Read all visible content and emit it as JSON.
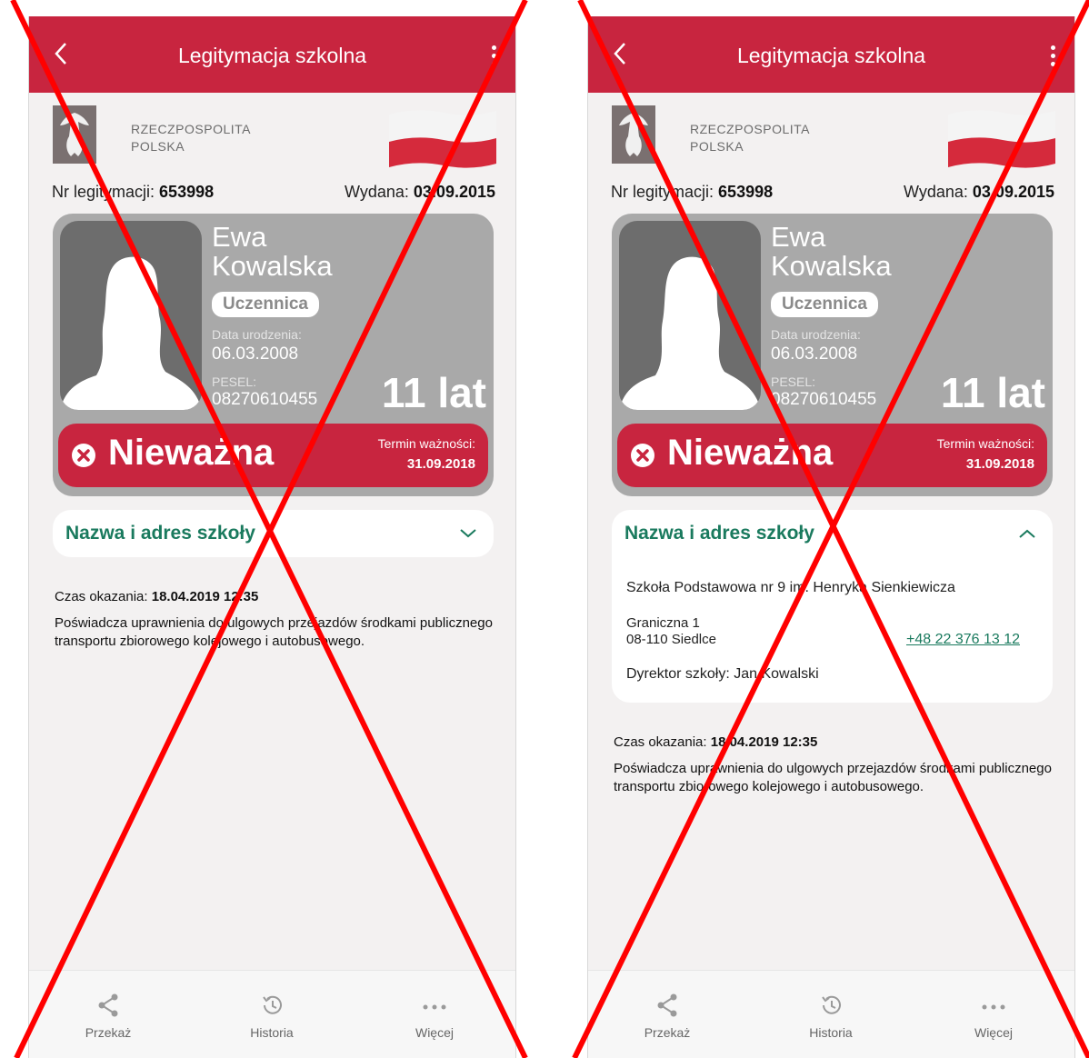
{
  "screens": [
    {
      "header": {
        "title": "Legitymacja szkolna"
      },
      "emblem": {
        "line1": "RZECZPOSPOLITA",
        "line2": "POLSKA"
      },
      "id_number": {
        "label": "Nr legitymacji:",
        "value": "653998"
      },
      "issued": {
        "label": "Wydana:",
        "value": "03.09.2015"
      },
      "card": {
        "first_name": "Ewa",
        "last_name": "Kowalska",
        "role": "Uczennica",
        "dob_label": "Data urodzenia:",
        "dob": "06.03.2008",
        "pesel_label": "PESEL:",
        "pesel": "08270610455",
        "age": "11 lat",
        "status": "Nieważna",
        "valid_label": "Termin ważności:",
        "valid_until": "31.09.2018"
      },
      "school": {
        "title": "Nazwa i adres szkoły",
        "expanded": false
      },
      "shown_time": {
        "label": "Czas okazania:",
        "value": "18.04.2019 12:35"
      },
      "entitlement": "Poświadcza uprawnienia do ulgowych przejazdów środkami publicznego transportu zbiorowego kolejowego i autobusowego.",
      "nav": {
        "share": "Przekaż",
        "history": "Historia",
        "more": "Więcej"
      }
    },
    {
      "header": {
        "title": "Legitymacja szkolna"
      },
      "emblem": {
        "line1": "RZECZPOSPOLITA",
        "line2": "POLSKA"
      },
      "id_number": {
        "label": "Nr legitymacji:",
        "value": "653998"
      },
      "issued": {
        "label": "Wydana:",
        "value": "03.09.2015"
      },
      "card": {
        "first_name": "Ewa",
        "last_name": "Kowalska",
        "role": "Uczennica",
        "dob_label": "Data urodzenia:",
        "dob": "06.03.2008",
        "pesel_label": "PESEL:",
        "pesel": "08270610455",
        "age": "11 lat",
        "status": "Nieważna",
        "valid_label": "Termin ważności:",
        "valid_until": "31.09.2018"
      },
      "school": {
        "title": "Nazwa i adres szkoły",
        "expanded": true,
        "name": "Szkoła Podstawowa nr 9 im. Henryka Sienkiewicza",
        "street": "Graniczna 1",
        "city": "08-110 Siedlce",
        "phone": "+48 22 376 13 12",
        "director": "Dyrektor szkoły: Jan Kowalski"
      },
      "shown_time": {
        "label": "Czas okazania:",
        "value": "18.04.2019 12:35"
      },
      "entitlement": "Poświadcza uprawnienia do ulgowych przejazdów środkami publicznego transportu zbiorowego kolejowego i autobusowego.",
      "nav": {
        "share": "Przekaż",
        "history": "Historia",
        "more": "Więcej"
      }
    }
  ],
  "colors": {
    "brand_red": "#c8253f",
    "link_green": "#1a7a5e",
    "overlay_red": "#ff0000"
  },
  "overlay": {
    "type": "red-x-cross"
  }
}
